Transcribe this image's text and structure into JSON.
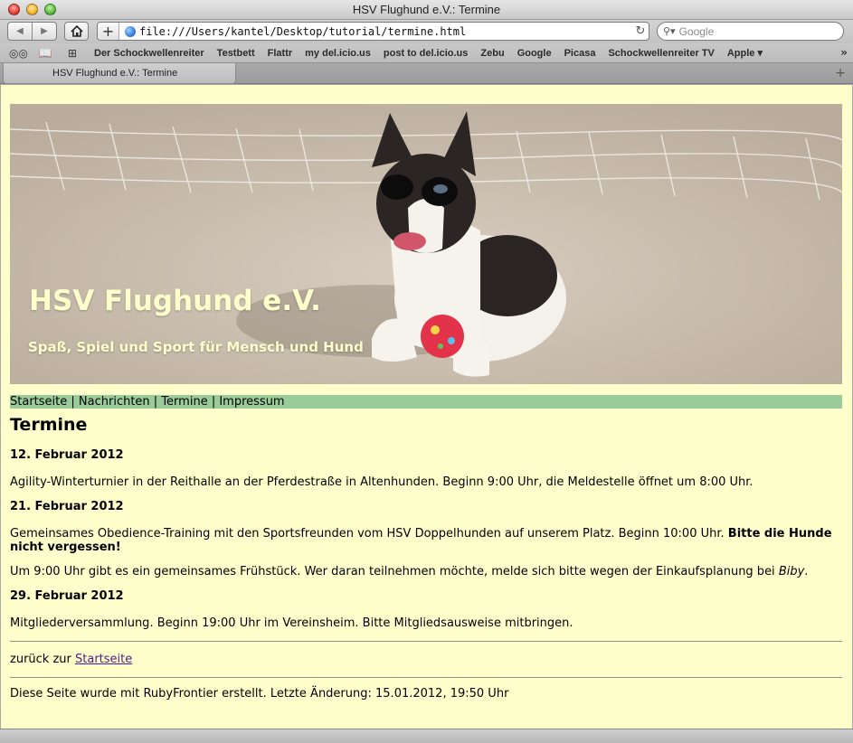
{
  "window": {
    "title": "HSV Flughund e.V.: Termine"
  },
  "toolbar": {
    "url": "file:///Users/kantel/Desktop/tutorial/termine.html",
    "search_placeholder": "Google"
  },
  "bookmarks": [
    "Der Schockwellenreiter",
    "Testbett",
    "Flattr",
    "my del.icio.us",
    "post to del.icio.us",
    "Zebu",
    "Google",
    "Picasa",
    "Schockwellenreiter TV",
    "Apple ▾"
  ],
  "tab": {
    "label": "HSV Flughund e.V.: Termine"
  },
  "header": {
    "title": "HSV Flughund e.V.",
    "subtitle": "Spaß, Spiel und Sport für Mensch und Hund"
  },
  "nav": {
    "links": [
      "Startseite",
      "Nachrichten",
      "Termine",
      "Impressum"
    ],
    "separator": " | "
  },
  "main": {
    "heading": "Termine",
    "events": [
      {
        "date": "12. Februar 2012",
        "p1": "Agility-Winterturnier in der Reithalle an der Pferdestraße in Altenhunden. Beginn 9:00 Uhr, die Meldestelle öffnet um 8:00 Uhr."
      },
      {
        "date": "21. Februar 2012",
        "p1": "Gemeinsames Obedience-Training mit den Sportsfreunden vom HSV Doppelhunden auf unserem Platz. Beginn 10:00 Uhr. ",
        "p1_bold": "Bitte die Hunde nicht vergessen!",
        "p2": "Um 9:00 Uhr gibt es ein gemeinsames Frühstück. Wer daran teilnehmen möchte, melde sich bitte wegen der Einkaufsplanung bei ",
        "p2_em": "Biby",
        "p2_end": "."
      },
      {
        "date": "29. Februar 2012",
        "p1": "Mitgliederversammlung. Beginn 19:00 Uhr im Vereinsheim. Bitte Mitgliedsausweise mitbringen."
      }
    ],
    "back_prefix": "zurück zur ",
    "back_link": "Startseite",
    "footer": "Diese Seite wurde mit RubyFrontier erstellt. Letzte Änderung: 15.01.2012, 19:50 Uhr"
  },
  "colors": {
    "page_bg": "#ffffcc",
    "nav_bg": "#99cc99",
    "header_text": "#ffffcc",
    "link": "#551a8b"
  }
}
